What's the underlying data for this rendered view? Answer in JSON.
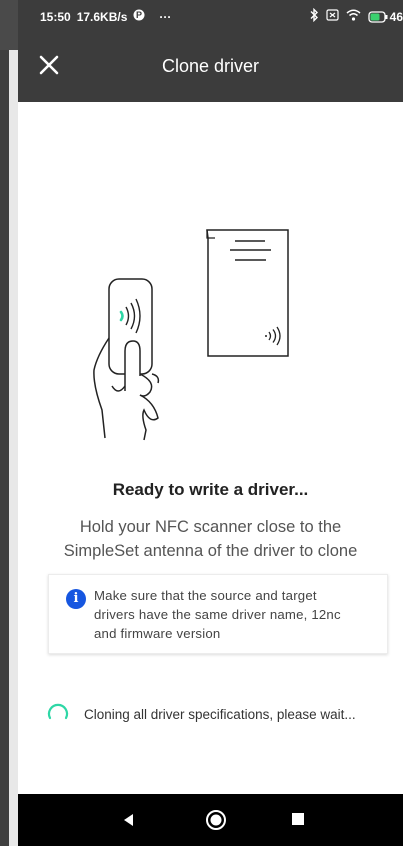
{
  "status_bar": {
    "time": "15:50",
    "speed": "17.6KB/s",
    "dots": "···",
    "battery": "46",
    "icons": [
      "pinterest-icon",
      "bluetooth-icon",
      "sim-off-icon",
      "wifi-icon",
      "battery-icon"
    ]
  },
  "app_bar": {
    "title": "Clone driver",
    "close_icon": "close-icon"
  },
  "illustration": {
    "elements": [
      "hand-holding-nfc-scanner",
      "driver-document-with-nfc-antenna"
    ],
    "accent_color": "#2ed7a6"
  },
  "content": {
    "heading": "Ready to write a driver...",
    "subtext_line1": "Hold your NFC scanner close to the",
    "subtext_line2": "SimpleSet antenna of the driver to clone",
    "info_icon": "info-icon",
    "info_line1": "Make sure that the source and target",
    "info_line2": "drivers have the same driver name, 12nc",
    "info_line3": "and firmware version"
  },
  "progress": {
    "text": "Cloning all driver specifications, please wait...",
    "color": "#2ed7a6"
  },
  "nav_bar": {
    "icons": [
      "back-icon",
      "home-icon",
      "recent-apps-icon"
    ]
  }
}
